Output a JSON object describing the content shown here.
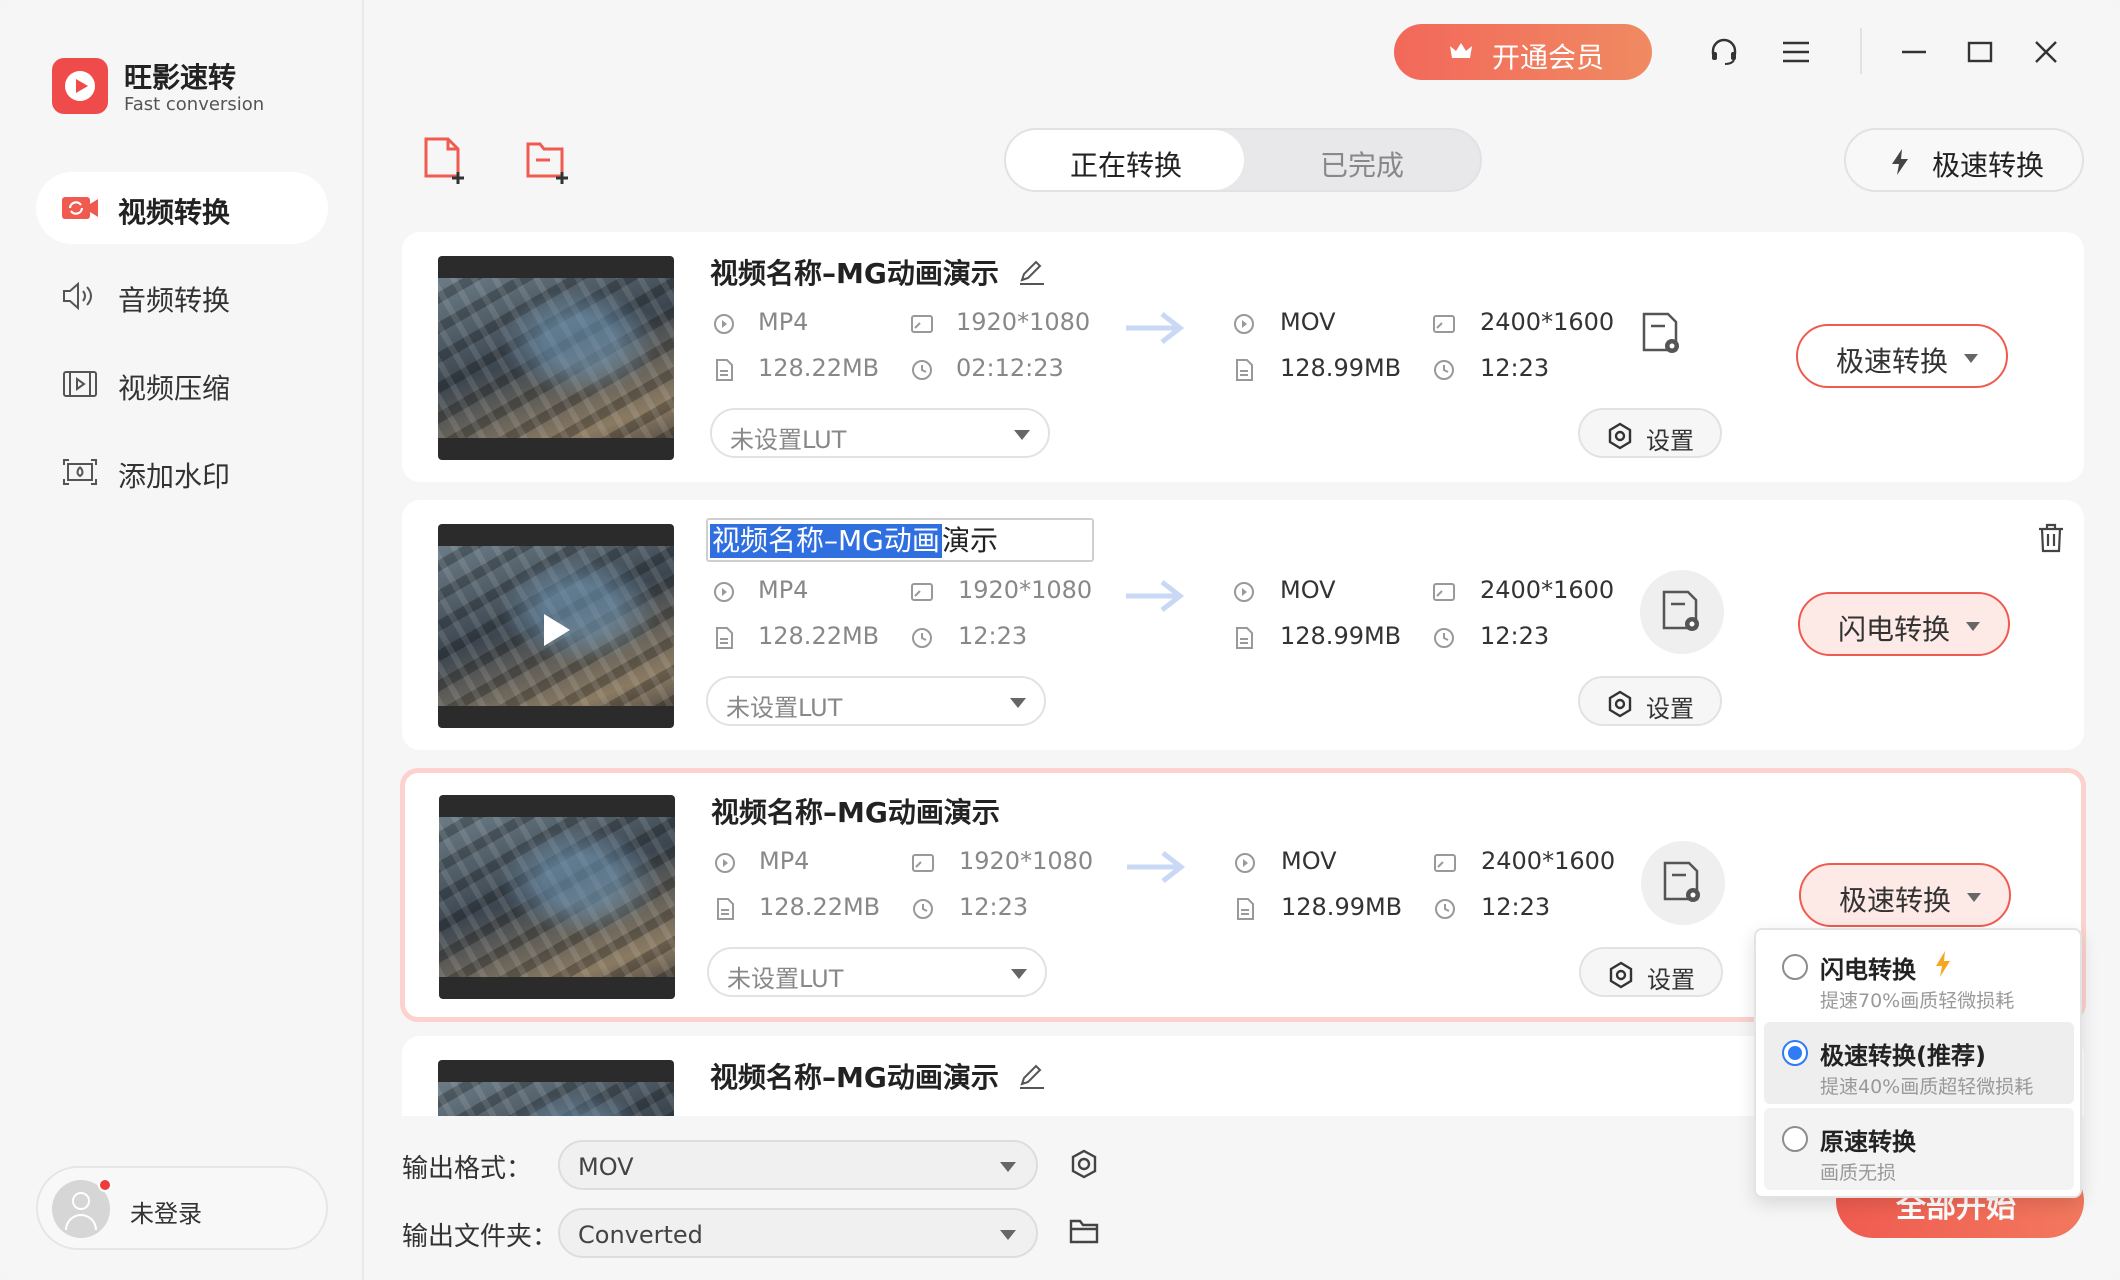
{
  "app": {
    "title": "旺影速转",
    "subtitle": "Fast conversion"
  },
  "header": {
    "vip_label": "开通会员"
  },
  "sidebar": {
    "items": [
      {
        "label": "视频转换",
        "active": true
      },
      {
        "label": "音频转换",
        "active": false
      },
      {
        "label": "视频压缩",
        "active": false
      },
      {
        "label": "添加水印",
        "active": false
      }
    ],
    "login_label": "未登录"
  },
  "toolbar": {
    "tab_converting": "正在转换",
    "tab_done": "已完成",
    "fast_all_label": "极速转换"
  },
  "cards": [
    {
      "title": "视频名称–MG动画演示",
      "src_format": "MP4",
      "src_res": "1920*1080",
      "src_size": "128.22MB",
      "src_duration": "02:12:23",
      "dst_format": "MOV",
      "dst_res": "2400*1600",
      "dst_size": "128.99MB",
      "dst_duration": "12:23",
      "lut": "未设置LUT",
      "settings_label": "设置",
      "convert_mode": "极速转换"
    },
    {
      "title_selected": "视频名称–MG动画",
      "title_rest": "演示",
      "src_format": "MP4",
      "src_res": "1920*1080",
      "src_size": "128.22MB",
      "src_duration": "12:23",
      "dst_format": "MOV",
      "dst_res": "2400*1600",
      "dst_size": "128.99MB",
      "dst_duration": "12:23",
      "lut": "未设置LUT",
      "settings_label": "设置",
      "convert_mode": "闪电转换"
    },
    {
      "title": "视频名称–MG动画演示",
      "src_format": "MP4",
      "src_res": "1920*1080",
      "src_size": "128.22MB",
      "src_duration": "12:23",
      "dst_format": "MOV",
      "dst_res": "2400*1600",
      "dst_size": "128.99MB",
      "dst_duration": "12:23",
      "lut": "未设置LUT",
      "settings_label": "设置",
      "convert_mode": "极速转换"
    },
    {
      "title": "视频名称–MG动画演示"
    }
  ],
  "bottom": {
    "format_label": "输出格式：",
    "format_value": "MOV",
    "folder_label": "输出文件夹：",
    "folder_value": "Converted",
    "start_label": "全部开始"
  },
  "dropdown": {
    "options": [
      {
        "label": "闪电转换",
        "sub": "提速70%画质轻微损耗",
        "selected": false
      },
      {
        "label": "极速转换(推荐)",
        "sub": "提速40%画质超轻微损耗",
        "selected": true
      },
      {
        "label": "原速转换",
        "sub": "画质无损",
        "selected": false
      }
    ]
  },
  "colors": {
    "accent": "#f05b50",
    "radio": "#2f7cf6",
    "selection": "#2f6fe0"
  }
}
